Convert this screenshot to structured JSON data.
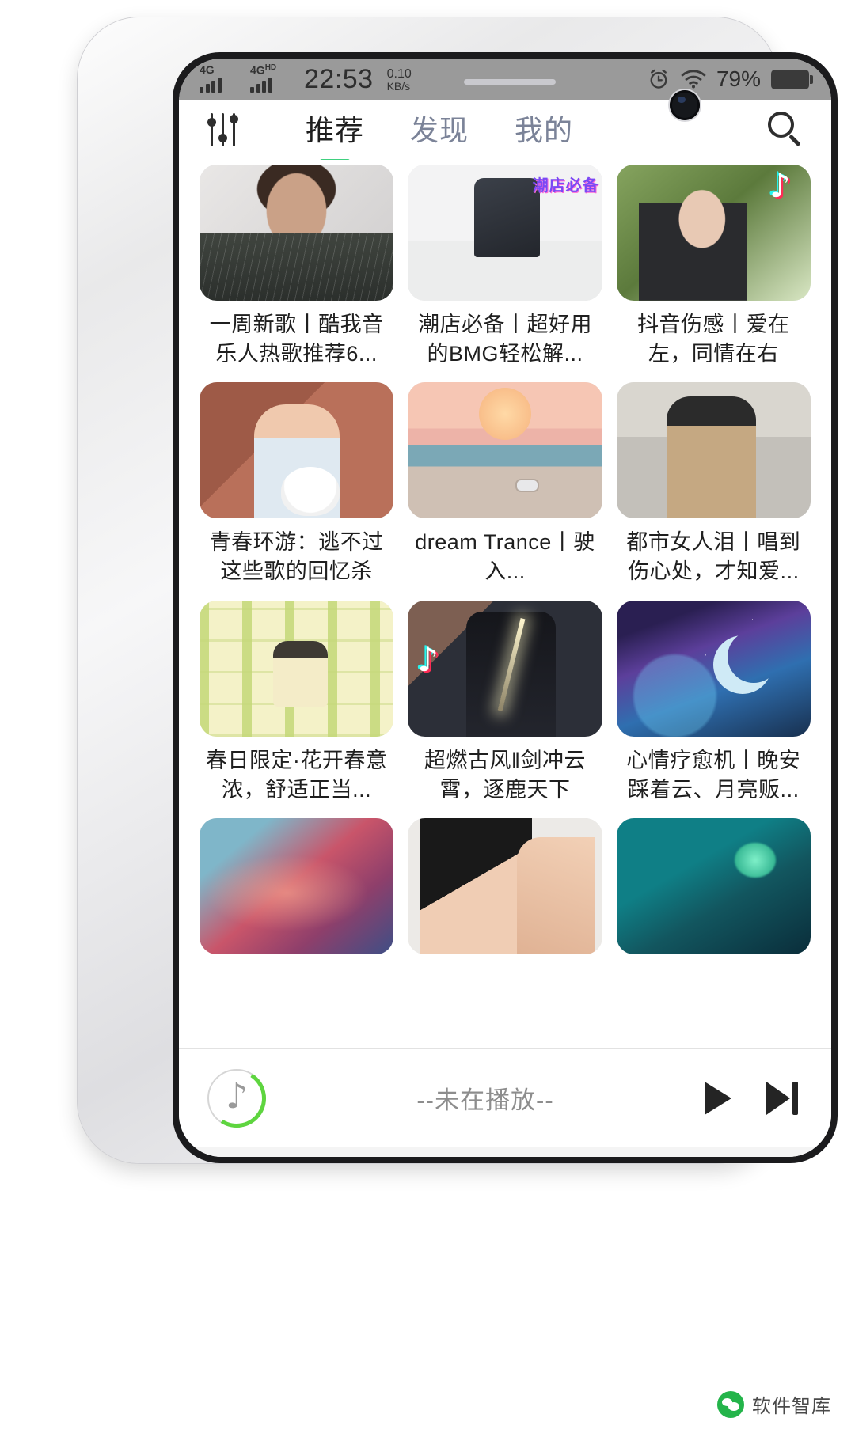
{
  "status_bar": {
    "network_1": "4G",
    "network_2": "4G",
    "network_2_sup": "HD",
    "time": "22:53",
    "speed_value": "0.10",
    "speed_unit": "KB/s",
    "alarm_icon": "alarm-clock-icon",
    "wifi_icon": "wifi-icon",
    "battery_percent": "79%"
  },
  "header": {
    "equalizer_icon": "equalizer-icon",
    "search_icon": "search-icon",
    "tabs": [
      {
        "label": "推荐",
        "active": true
      },
      {
        "label": "发现",
        "active": false
      },
      {
        "label": "我的",
        "active": false
      }
    ],
    "accent_color": "#3fd07f",
    "inactive_color": "#7b8398",
    "active_color": "#1e1e1e"
  },
  "grid": {
    "cards": [
      {
        "title": "一周新歌丨酷我音乐人热歌推荐6...",
        "art": "a-idol",
        "badge": null
      },
      {
        "title": "潮店必备丨超好用的BMG轻松解...",
        "art": "a-anime",
        "badge": null
      },
      {
        "title": "抖音伤感丨爱在左，同情在右",
        "art": "a-girl1",
        "badge": "tiktok-icon"
      },
      {
        "title": "青春环游：逃不过这些歌的回忆杀",
        "art": "a-student",
        "badge": null
      },
      {
        "title": "dream Trance丨驶入...",
        "art": "a-moon",
        "badge": null
      },
      {
        "title": "都市女人泪丨唱到伤心处，才知爱...",
        "art": "a-city",
        "badge": null
      },
      {
        "title": "春日限定·花开春意浓，舒适正当...",
        "art": "a-bamboo",
        "badge": null
      },
      {
        "title": "超燃古风‖剑冲云霄，逐鹿天下",
        "art": "a-samurai",
        "badge": "tiktok-icon"
      },
      {
        "title": "心情疗愈机丨晚安踩着云、月亮贩...",
        "art": "a-moonfox",
        "badge": null
      },
      {
        "title": "",
        "art": "a-coral",
        "badge": null
      },
      {
        "title": "",
        "art": "a-wet",
        "badge": null
      },
      {
        "title": "",
        "art": "a-teal",
        "badge": null
      }
    ]
  },
  "player": {
    "disc_icon": "music-note-disc-icon",
    "title": "--未在播放--",
    "play_icon": "play-icon",
    "next_icon": "next-track-icon",
    "accent_color": "#5ed53f"
  },
  "android_nav": {
    "recents_icon": "square-recents-icon",
    "home_icon": "circle-home-icon",
    "back_icon": "triangle-back-icon"
  },
  "watermark": {
    "logo_icon": "wechat-logo-icon",
    "text": "软件智库"
  }
}
